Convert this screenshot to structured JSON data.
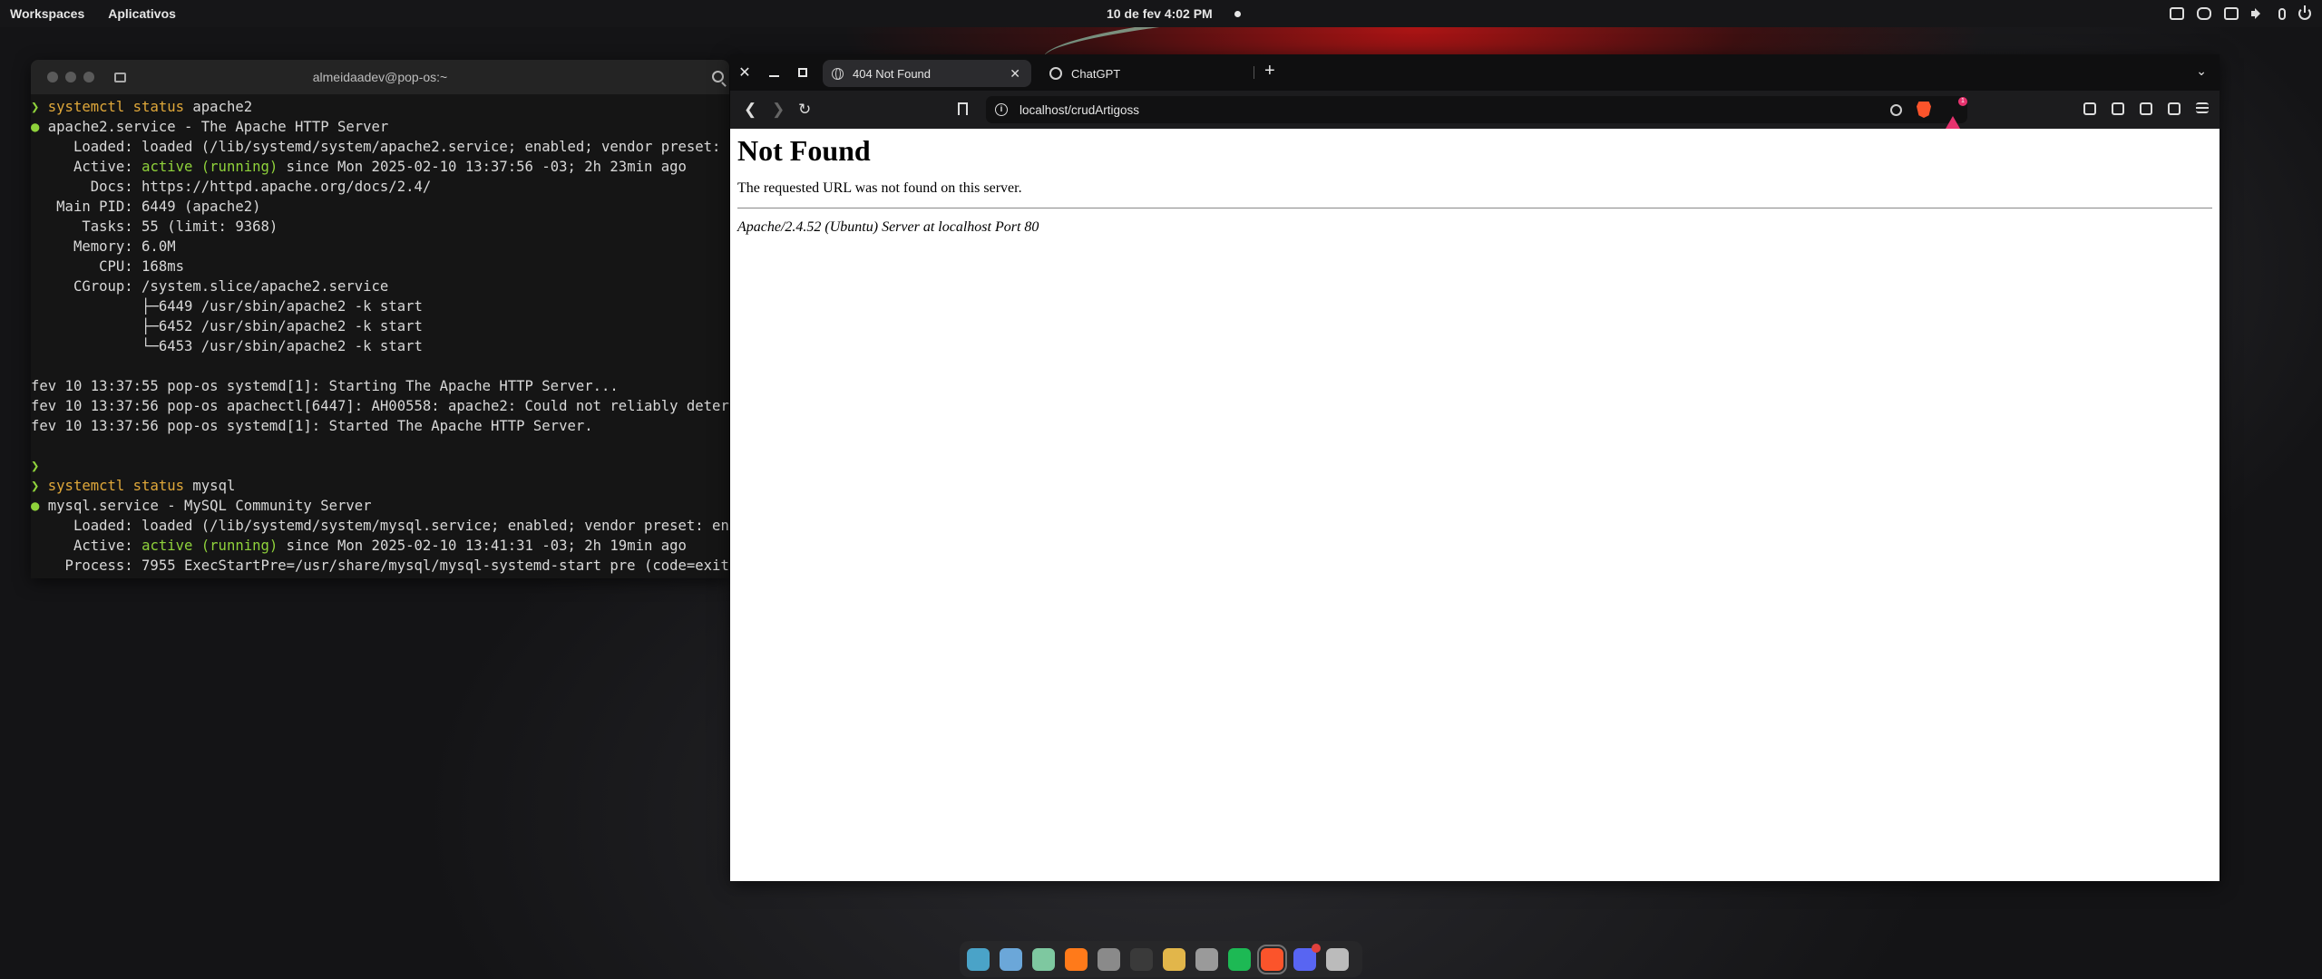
{
  "topbar": {
    "workspaces": "Workspaces",
    "apps": "Aplicativos",
    "clock": "10 de fev   4:02 PM",
    "tray_icons": [
      "display-icon",
      "discord-tray-icon",
      "window-icon",
      "speaker-icon",
      "mic-icon",
      "power-icon"
    ]
  },
  "terminal": {
    "title": "almeidaadev@pop-os:~",
    "lines": [
      {
        "prompt": "❯ ",
        "cmd": "systemctl",
        "rest": " ",
        "cmd2": "status",
        "rest2": " apache2"
      },
      {
        "bullet": "● ",
        "text": "apache2.service - The Apache HTTP Server"
      },
      {
        "text": "     Loaded: loaded (/lib/systemd/system/apache2.service; enabled; vendor preset: enabled)"
      },
      {
        "text": "     Active: ",
        "green": "active (running)",
        "text2": " since Mon 2025-02-10 13:37:56 -03; 2h 23min ago"
      },
      {
        "text": "       Docs: https://httpd.apache.org/docs/2.4/"
      },
      {
        "text": "   Main PID: 6449 (apache2)"
      },
      {
        "text": "      Tasks: 55 (limit: 9368)"
      },
      {
        "text": "     Memory: 6.0M"
      },
      {
        "text": "        CPU: 168ms"
      },
      {
        "text": "     CGroup: /system.slice/apache2.service"
      },
      {
        "text": "             ├─6449 /usr/sbin/apache2 -k start"
      },
      {
        "text": "             ├─6452 /usr/sbin/apache2 -k start"
      },
      {
        "text": "             └─6453 /usr/sbin/apache2 -k start"
      },
      {
        "text": ""
      },
      {
        "text": "fev 10 13:37:55 pop-os systemd[1]: Starting The Apache HTTP Server..."
      },
      {
        "text": "fev 10 13:37:56 pop-os apachectl[6447]: AH00558: apache2: Could not reliably determine"
      },
      {
        "text": "fev 10 13:37:56 pop-os systemd[1]: Started The Apache HTTP Server."
      },
      {
        "text": ""
      },
      {
        "prompt": "❯",
        "text": ""
      },
      {
        "prompt": "❯ ",
        "cmd": "systemctl",
        "rest": " ",
        "cmd2": "status",
        "rest2": " mysql"
      },
      {
        "bullet": "● ",
        "text": "mysql.service - MySQL Community Server"
      },
      {
        "text": "     Loaded: loaded (/lib/systemd/system/mysql.service; enabled; vendor preset: enabled)"
      },
      {
        "text": "     Active: ",
        "green": "active (running)",
        "text2": " since Mon 2025-02-10 13:41:31 -03; 2h 19min ago"
      },
      {
        "text": "    Process: 7955 ExecStartPre=/usr/share/mysql/mysql-systemd-start pre (code=exited)"
      }
    ]
  },
  "browser": {
    "tabs": [
      {
        "label": "404 Not Found",
        "active": true
      },
      {
        "label": "ChatGPT",
        "active": false
      }
    ],
    "new_tab": "+",
    "close_tab": "✕",
    "url": "localhost/crudArtigoss",
    "rewards_count": "1",
    "page": {
      "heading": "Not Found",
      "message": "The requested URL was not found on this server.",
      "server": "Apache/2.4.52 (Ubuntu) Server at localhost Port 80"
    }
  },
  "dock": {
    "items": [
      {
        "name": "workspaces-icon",
        "color": "#4aa3c8"
      },
      {
        "name": "launcher-icon",
        "color": "#6ba7d9"
      },
      {
        "name": "app-grid-icon",
        "color": "#7ec8a0"
      },
      {
        "name": "firefox-icon",
        "color": "#ff7a1a"
      },
      {
        "name": "files-icon",
        "color": "#8a8a8a"
      },
      {
        "name": "terminal-icon",
        "color": "#3a3a3a"
      },
      {
        "name": "notes-icon",
        "color": "#e2b64a"
      },
      {
        "name": "settings-icon",
        "color": "#9a9a9a"
      },
      {
        "name": "spotify-icon",
        "color": "#1db954"
      },
      {
        "name": "brave-icon",
        "color": "#fb542b"
      },
      {
        "name": "discord-icon",
        "color": "#5865f2"
      },
      {
        "name": "screenshot-icon",
        "color": "#bbbbbb"
      }
    ]
  }
}
